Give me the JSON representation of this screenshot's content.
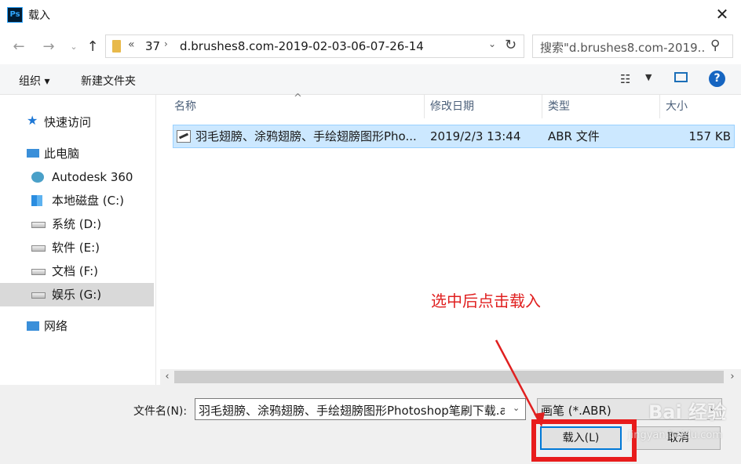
{
  "window": {
    "title": "载入",
    "app_icon": "Ps"
  },
  "nav": {
    "back_icon": "arrow-left-icon",
    "forward_icon": "arrow-right-icon",
    "up_icon": "arrow-up-icon",
    "address": {
      "overflow": "«",
      "crumbs": [
        "37",
        "d.brushes8.com-2019-02-03-06-07-26-14"
      ],
      "sep": "›"
    },
    "search_placeholder": "搜索\"d.brushes8.com-2019..."
  },
  "toolbar": {
    "organize": "组织 ▾",
    "new_folder": "新建文件夹"
  },
  "sidebar": {
    "items": [
      {
        "label": "快速访问",
        "icon": "star-icon"
      },
      {
        "label": "此电脑",
        "icon": "computer-icon"
      },
      {
        "label": "Autodesk 360",
        "icon": "cloud-icon"
      },
      {
        "label": "本地磁盘 (C:)",
        "icon": "windows-drive-icon"
      },
      {
        "label": "系统 (D:)",
        "icon": "drive-icon"
      },
      {
        "label": "软件 (E:)",
        "icon": "drive-icon"
      },
      {
        "label": "文档 (F:)",
        "icon": "drive-icon"
      },
      {
        "label": "娱乐 (G:)",
        "icon": "drive-icon"
      },
      {
        "label": "网络",
        "icon": "network-icon"
      }
    ]
  },
  "columns": [
    "名称",
    "修改日期",
    "类型",
    "大小"
  ],
  "files": [
    {
      "name": "羽毛翅膀、涂鸦翅膀、手绘翅膀图形Pho...",
      "modified": "2019/2/3 13:44",
      "type": "ABR 文件",
      "size": "157 KB"
    }
  ],
  "bottom": {
    "filename_label": "文件名(N):",
    "filename_value": "羽毛翅膀、涂鸦翅膀、手绘翅膀图形Photoshop笔刷下载.abr",
    "filetype_value": "画笔 (*.ABR)",
    "load_button": "载入(L)",
    "cancel_button": "取消"
  },
  "annotation": {
    "text": "选中后点击载入",
    "color": "#e02020"
  },
  "watermark": {
    "text": "Bai 经验",
    "sub": "jingyan.baidu.com"
  }
}
